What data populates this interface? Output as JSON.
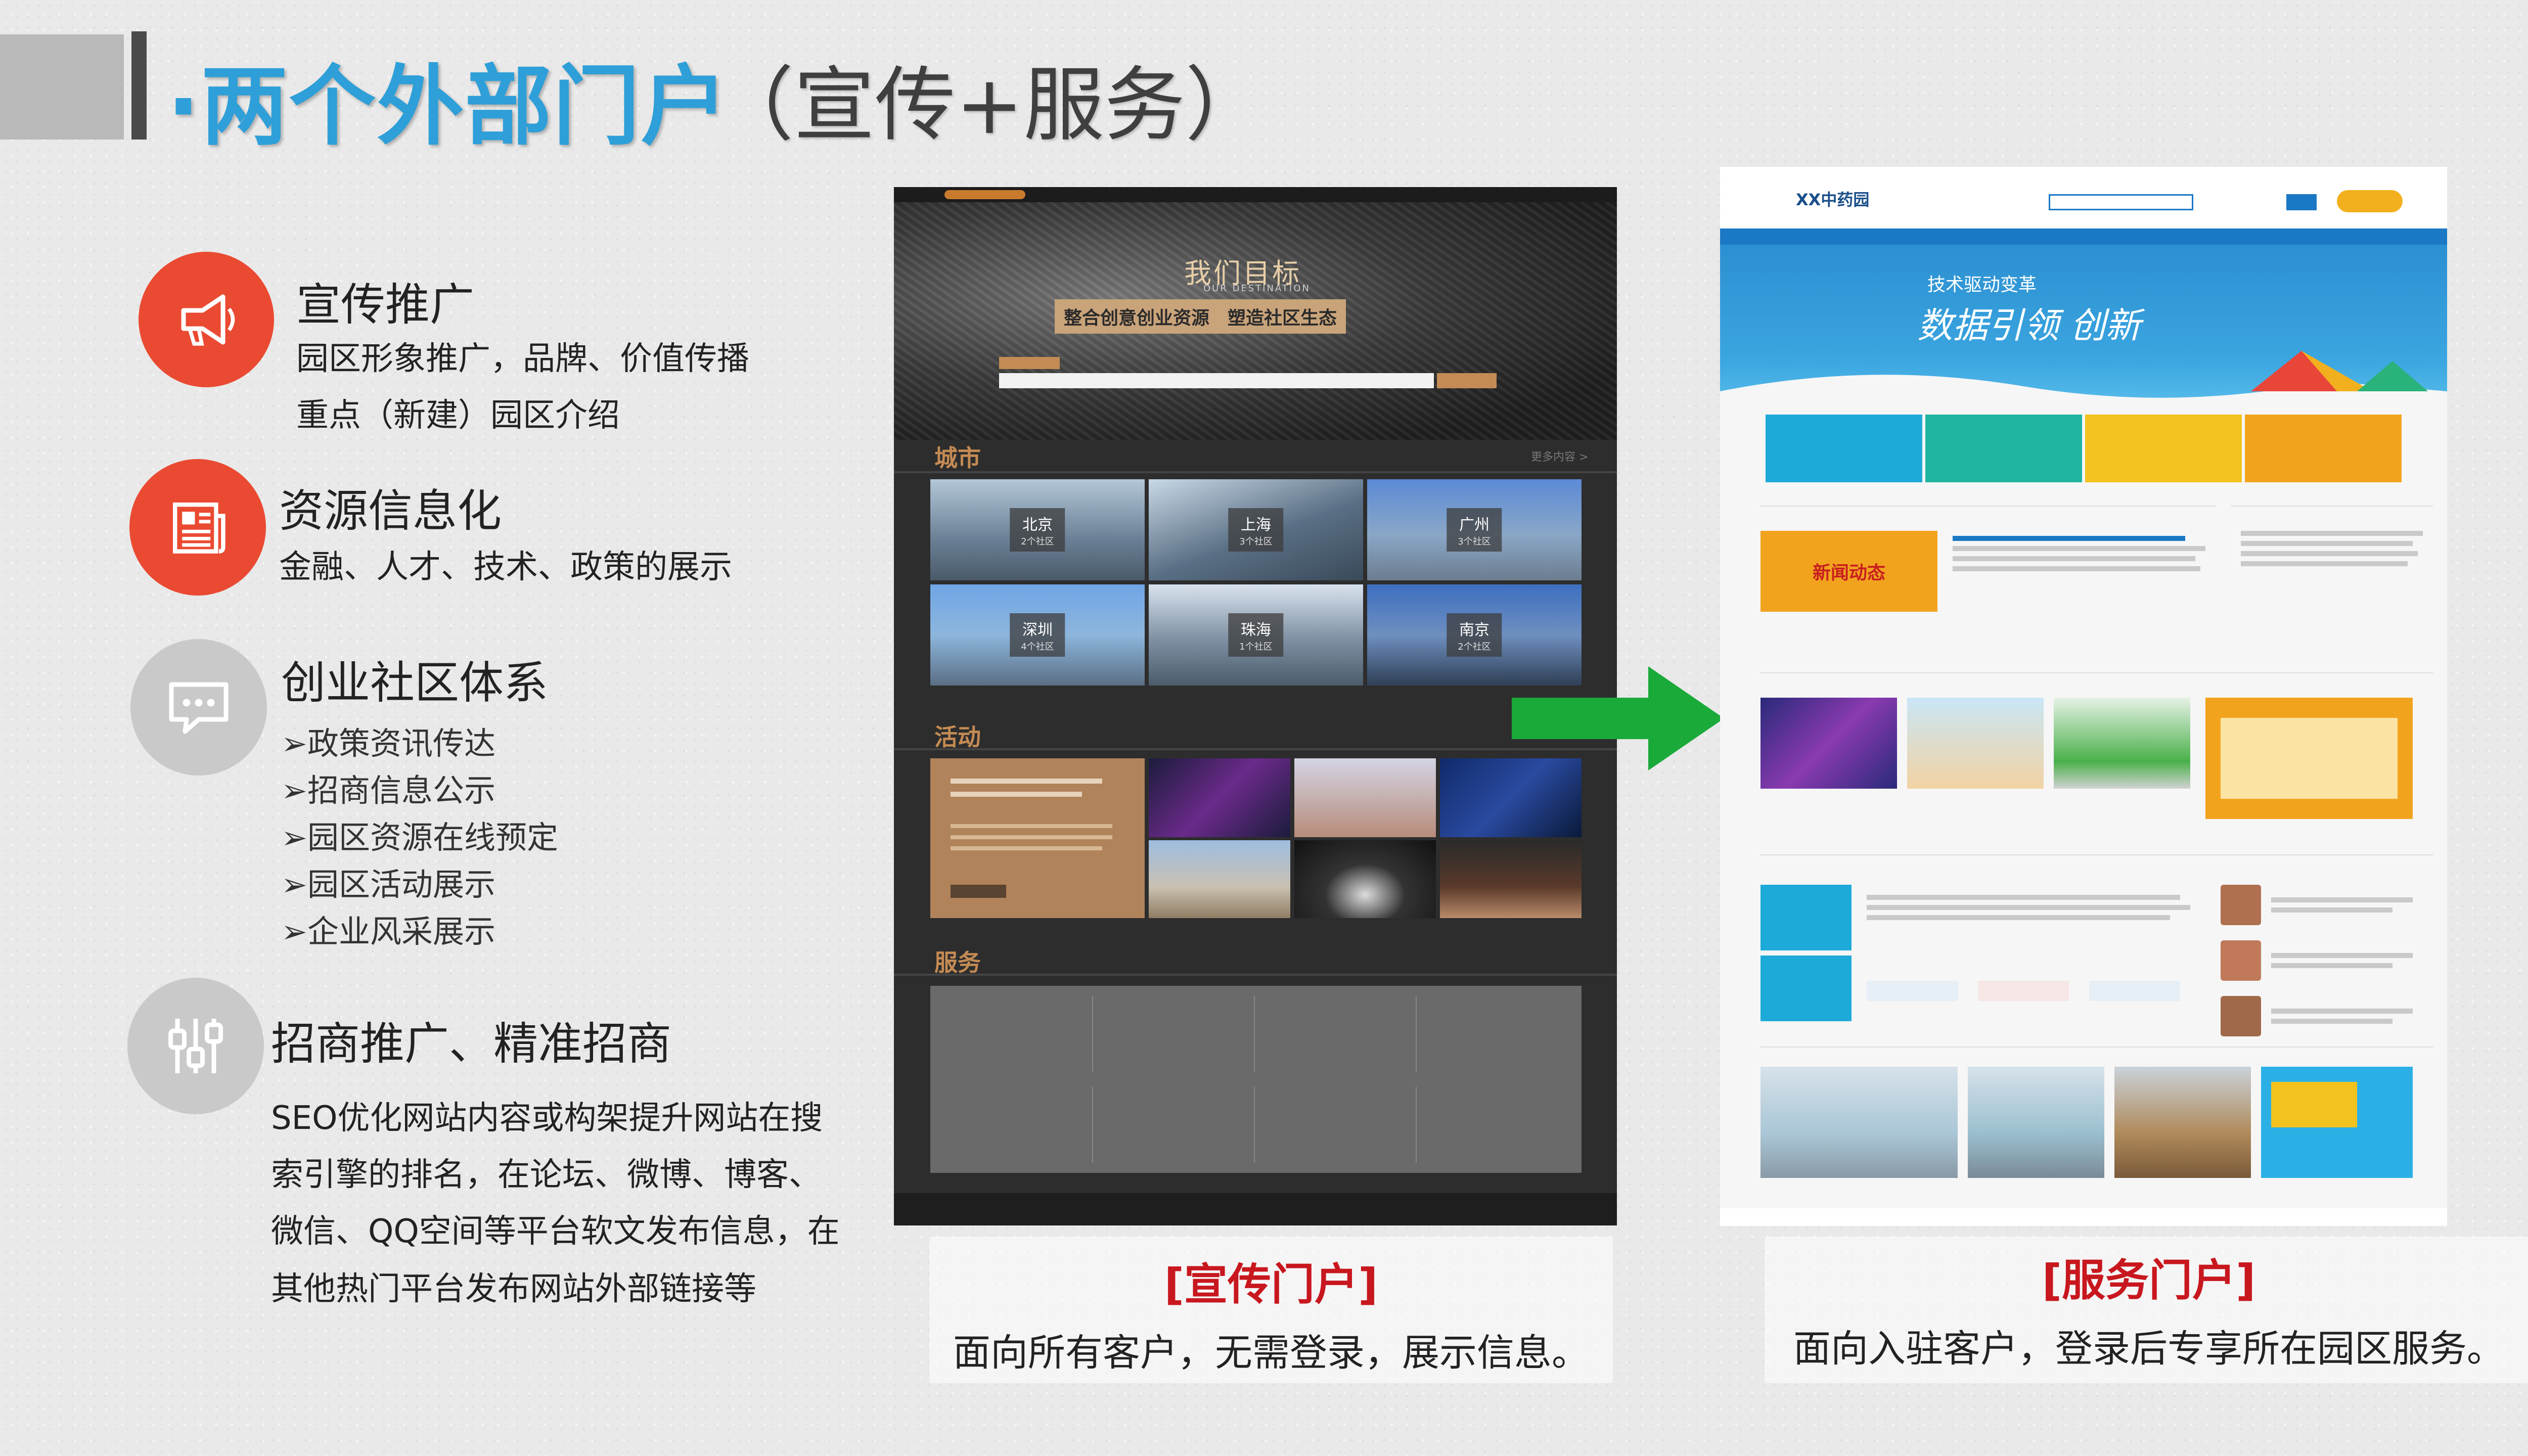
{
  "header": {
    "title_main": "·两个外部门户",
    "title_sub": "（宣传+服务）"
  },
  "features": [
    {
      "title": "宣传推广",
      "lines": [
        "园区形象推广，品牌、价值传播",
        "重点（新建）园区介绍"
      ],
      "icon": "megaphone-icon",
      "color": "#ea4a32"
    },
    {
      "title": "资源信息化",
      "lines": [
        "金融、人才、技术、政策的展示"
      ],
      "icon": "newspaper-icon",
      "color": "#ea4a32"
    },
    {
      "title": "创业社区体系",
      "bullets": [
        "➢政策资讯传达",
        "➢招商信息公示",
        "➢园区资源在线预定",
        "➢园区活动展示",
        "➢企业风采展示"
      ],
      "icon": "chat-icon",
      "color": "#c9c9c9"
    },
    {
      "title": "招商推广、精准招商",
      "lines": [
        "SEO优化网站内容或构架提升网站在搜",
        "索引擎的排名，在论坛、微博、博客、",
        "微信、QQ空间等平台软文发布信息，在",
        "其他热门平台发布网站外部链接等"
      ],
      "icon": "sliders-icon",
      "color": "#c9c9c9"
    }
  ],
  "promo_portal": {
    "banner_title": "我们目标",
    "banner_sub": "OUR DESTINATION",
    "banner_slogan": "整合创意创业资源　塑造社区生态",
    "section_city": "城市",
    "section_activity": "活动",
    "section_service": "服务",
    "more": "更多内容 >",
    "cities": [
      {
        "name": "北京",
        "sub": "2个社区"
      },
      {
        "name": "上海",
        "sub": "3个社区"
      },
      {
        "name": "广州",
        "sub": "3个社区"
      },
      {
        "name": "深圳",
        "sub": "4个社区"
      },
      {
        "name": "珠海",
        "sub": "1个社区"
      },
      {
        "name": "南京",
        "sub": "2个社区"
      }
    ],
    "caption_title": "[宣传门户]",
    "caption_text": "面向所有客户，无需登录，展示信息。"
  },
  "service_portal": {
    "logo": "XX中药园",
    "banner_line1": "技术驱动变革",
    "banner_line2": "数据引领 创新",
    "news_label": "新闻动态",
    "caption_title": "[服务门户]",
    "caption_text": "面向入驻客户，登录后专享所在园区服务。"
  },
  "arrow_color": "#1aaa3a",
  "accent_title": "#2e9fd8",
  "accent_red": "#c8171e"
}
